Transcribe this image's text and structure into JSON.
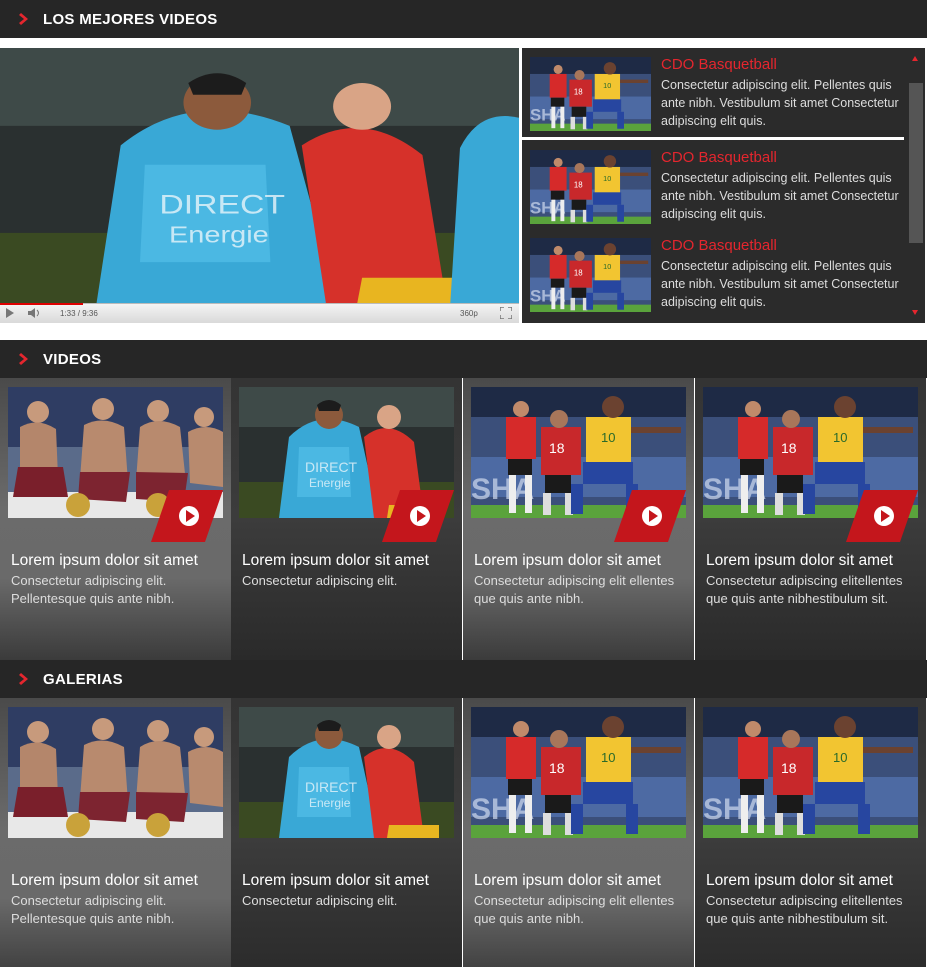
{
  "sections": {
    "best_videos": "LOS MEJORES VIDEOS",
    "videos": "VIDEOS",
    "galleries": "GALERIAS"
  },
  "player": {
    "time": "1:33 / 9:36",
    "quality": "360p",
    "progress": 0.16
  },
  "playlist": [
    {
      "title": "CDO Basquetball",
      "desc": "Consectetur adipiscing elit. Pellentes quis ante nibh. Vestibulum sit amet Consectetur adipiscing elit quis."
    },
    {
      "title": "CDO Basquetball",
      "desc": "Consectetur adipiscing elit. Pellentes quis ante nibh. Vestibulum sit amet Consectetur adipiscing elit quis."
    },
    {
      "title": "CDO Basquetball",
      "desc": "Consectetur adipiscing elit. Pellentes quis ante nibh. Vestibulum sit amet Consectetur adipiscing elit quis."
    }
  ],
  "videos": [
    {
      "title": "Lorem ipsum dolor sit amet",
      "desc": "Consectetur adipiscing elit. Pellentesque quis ante nibh."
    },
    {
      "title": "Lorem ipsum dolor sit amet",
      "desc": "Consectetur adipiscing elit."
    },
    {
      "title": "Lorem ipsum dolor sit amet",
      "desc": "Consectetur adipiscing elit ellentes que quis ante nibh."
    },
    {
      "title": "Lorem ipsum dolor sit amet",
      "desc": "Consectetur adipiscing elitellentes que quis ante nibhestibulum sit."
    }
  ],
  "galleries": [
    {
      "title": "Lorem ipsum dolor sit amet",
      "desc": "Consectetur adipiscing elit. Pellentesque quis ante nibh."
    },
    {
      "title": "Lorem ipsum dolor sit amet",
      "desc": "Consectetur adipiscing elit."
    },
    {
      "title": "Lorem ipsum dolor sit amet",
      "desc": "Consectetur adipiscing elit ellentes que quis ante nibh."
    },
    {
      "title": "Lorem ipsum dolor sit amet",
      "desc": "Consectetur adipiscing elitellentes que quis ante nibhestibulum sit."
    }
  ],
  "colors": {
    "accent": "#e4262e",
    "bar": "#262626",
    "player_bg": "#2b2b2b"
  }
}
